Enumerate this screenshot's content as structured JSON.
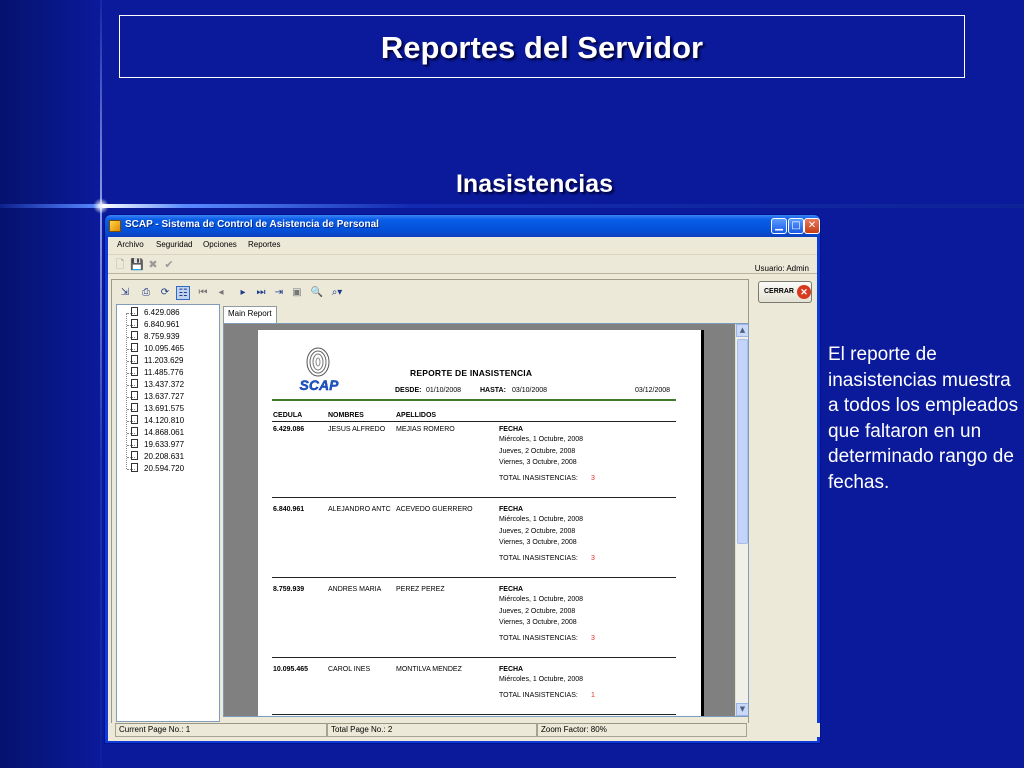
{
  "slide": {
    "title": "Reportes del Servidor",
    "subtitle": "Inasistencias",
    "description": "El reporte de inasistencias muestra a todos los empleados que faltaron en un determinado rango de fechas."
  },
  "window": {
    "title": "SCAP - Sistema de Control de Asistencia de Personal",
    "controls": [
      "minimize",
      "maximize",
      "close"
    ]
  },
  "menu": [
    "Archivo",
    "Seguridad",
    "Opciones",
    "Reportes"
  ],
  "toolbar": {
    "icons": [
      "new-icon",
      "save-icon",
      "delete-icon",
      "check-icon"
    ],
    "user_label": "Usuario: Admin"
  },
  "viewer": {
    "tab": "Main Report",
    "tree_items": [
      "6.429.086",
      "6.840.961",
      "8.759.939",
      "10.095.465",
      "11.203.629",
      "11.485.776",
      "13.437.372",
      "13.637.727",
      "13.691.575",
      "14.120.810",
      "14.868.061",
      "19.633.977",
      "20.208.631",
      "20.594.720"
    ]
  },
  "report": {
    "logo_text": "SCAP",
    "title": "REPORTE DE INASISTENCIA",
    "desde_label": "DESDE:",
    "desde_value": "01/10/2008",
    "hasta_label": "HASTA:",
    "hasta_value": "03/10/2008",
    "print_date": "03/12/2008",
    "columns": [
      "CEDULA",
      "NOMBRES",
      "APELLIDOS"
    ],
    "fecha_label": "FECHA",
    "total_label": "TOTAL INASISTENCIAS:",
    "records": [
      {
        "cedula": "6.429.086",
        "nombres": "JESUS ALFREDO",
        "apellidos": "MEJIAS ROMERO",
        "dates": [
          "Miércoles, 1 Octubre, 2008",
          "Jueves, 2 Octubre, 2008",
          "Viernes, 3 Octubre, 2008"
        ],
        "total": "3"
      },
      {
        "cedula": "6.840.961",
        "nombres": "ALEJANDRO ANTC",
        "apellidos": "ACEVEDO GUERRERO",
        "dates": [
          "Miércoles, 1 Octubre, 2008",
          "Jueves, 2 Octubre, 2008",
          "Viernes, 3 Octubre, 2008"
        ],
        "total": "3"
      },
      {
        "cedula": "8.759.939",
        "nombres": "ANDRES MARIA",
        "apellidos": "PEREZ PEREZ",
        "dates": [
          "Miércoles, 1 Octubre, 2008",
          "Jueves, 2 Octubre, 2008",
          "Viernes, 3 Octubre, 2008"
        ],
        "total": "3"
      },
      {
        "cedula": "10.095.465",
        "nombres": "CAROL INES",
        "apellidos": "MONTILVA MENDEZ",
        "dates": [
          "Miércoles, 1 Octubre, 2008"
        ],
        "total": "1"
      }
    ]
  },
  "close_button": "CERRAR",
  "status": {
    "current_page": "Current Page No.: 1",
    "total_page": "Total Page No.: 2",
    "zoom": "Zoom Factor: 80%"
  }
}
